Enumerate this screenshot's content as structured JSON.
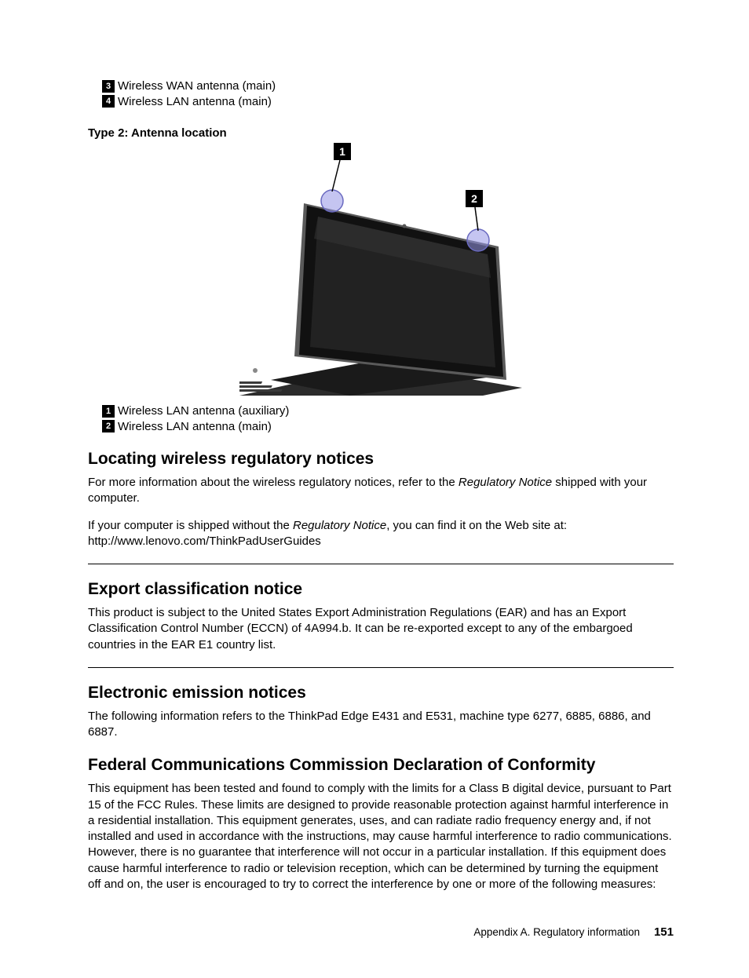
{
  "legend_top": {
    "items": [
      {
        "num": "3",
        "text": "Wireless WAN antenna (main)"
      },
      {
        "num": "4",
        "text": "Wireless LAN antenna (main)"
      }
    ]
  },
  "type2_heading": "Type 2: Antenna location",
  "figure_callouts": {
    "c1": "1",
    "c2": "2"
  },
  "legend_bottom": {
    "items": [
      {
        "num": "1",
        "text": "Wireless LAN antenna (auxiliary)"
      },
      {
        "num": "2",
        "text": "Wireless LAN antenna (main)"
      }
    ]
  },
  "sections": {
    "locating": {
      "title": "Locating wireless regulatory notices",
      "p1a": "For more information about the wireless regulatory notices, refer to the ",
      "p1b": "Regulatory Notice",
      "p1c": " shipped with your computer.",
      "p2a": "If your computer is shipped without the ",
      "p2b": "Regulatory Notice",
      "p2c": ", you can find it on the Web site at: http://www.lenovo.com/ThinkPadUserGuides"
    },
    "export": {
      "title": "Export classification notice",
      "p1": "This product is subject to the United States Export Administration Regulations (EAR) and has an Export Classification Control Number (ECCN) of 4A994.b. It can be re-exported except to any of the embargoed countries in the EAR E1 country list."
    },
    "emission": {
      "title": "Electronic emission notices",
      "p1": "The following information refers to the ThinkPad Edge E431 and E531, machine type 6277, 6885, 6886, and 6887."
    },
    "fcc": {
      "title": "Federal Communications Commission Declaration of Conformity",
      "p1": "This equipment has been tested and found to comply with the limits for a Class B digital device, pursuant to Part 15 of the FCC Rules. These limits are designed to provide reasonable protection against harmful interference in a residential installation. This equipment generates, uses, and can radiate radio frequency energy and, if not installed and used in accordance with the instructions, may cause harmful interference to radio communications. However, there is no guarantee that interference will not occur in a particular installation. If this equipment does cause harmful interference to radio or television reception, which can be determined by turning the equipment off and on, the user is encouraged to try to correct the interference by one or more of the following measures:"
    }
  },
  "footer": {
    "section": "Appendix A. Regulatory information",
    "page": "151"
  }
}
